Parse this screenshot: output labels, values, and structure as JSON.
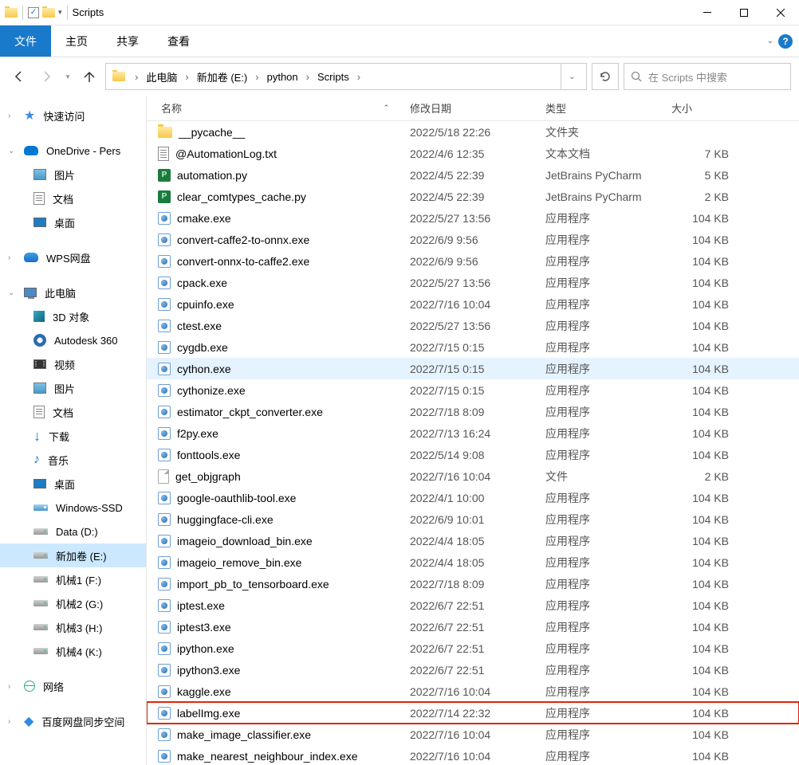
{
  "title": {
    "sep": "|",
    "window": "Scripts"
  },
  "ribbon": {
    "file": "文件",
    "tabs": [
      "主页",
      "共享",
      "查看"
    ]
  },
  "breadcrumb": {
    "items": [
      "此电脑",
      "新加卷 (E:)",
      "python",
      "Scripts"
    ]
  },
  "search": {
    "placeholder": "在 Scripts 中搜索"
  },
  "sidebar": {
    "quick": {
      "root": "快速访问"
    },
    "onedrive": {
      "root": "OneDrive - Pers",
      "items": [
        "图片",
        "文档",
        "桌面"
      ]
    },
    "wps": {
      "root": "WPS网盘"
    },
    "pc": {
      "root": "此电脑",
      "items": [
        {
          "label": "3D 对象",
          "icon": "3d"
        },
        {
          "label": "Autodesk 360",
          "icon": "a360"
        },
        {
          "label": "视频",
          "icon": "video"
        },
        {
          "label": "图片",
          "icon": "pic"
        },
        {
          "label": "文档",
          "icon": "doc"
        },
        {
          "label": "下载",
          "icon": "dl"
        },
        {
          "label": "音乐",
          "icon": "music"
        },
        {
          "label": "桌面",
          "icon": "desk"
        },
        {
          "label": "Windows-SSD",
          "icon": "ssd"
        },
        {
          "label": "Data (D:)",
          "icon": "drive"
        },
        {
          "label": "新加卷 (E:)",
          "icon": "drive",
          "selected": true
        },
        {
          "label": "机械1 (F:)",
          "icon": "drive"
        },
        {
          "label": "机械2 (G:)",
          "icon": "drive"
        },
        {
          "label": "机械3 (H:)",
          "icon": "drive"
        },
        {
          "label": "机械4 (K:)",
          "icon": "drive"
        }
      ]
    },
    "network": {
      "root": "网络"
    },
    "baidu": {
      "root": "百度网盘同步空间"
    }
  },
  "columns": {
    "name": "名称",
    "date": "修改日期",
    "type": "类型",
    "size": "大小"
  },
  "files": [
    {
      "name": "__pycache__",
      "date": "2022/5/18 22:26",
      "type": "文件夹",
      "size": "",
      "icon": "folder"
    },
    {
      "name": "@AutomationLog.txt",
      "date": "2022/4/6 12:35",
      "type": "文本文档",
      "size": "7 KB",
      "icon": "txt"
    },
    {
      "name": "automation.py",
      "date": "2022/4/5 22:39",
      "type": "JetBrains PyCharm",
      "size": "5 KB",
      "icon": "py"
    },
    {
      "name": "clear_comtypes_cache.py",
      "date": "2022/4/5 22:39",
      "type": "JetBrains PyCharm",
      "size": "2 KB",
      "icon": "py"
    },
    {
      "name": "cmake.exe",
      "date": "2022/5/27 13:56",
      "type": "应用程序",
      "size": "104 KB",
      "icon": "exe"
    },
    {
      "name": "convert-caffe2-to-onnx.exe",
      "date": "2022/6/9 9:56",
      "type": "应用程序",
      "size": "104 KB",
      "icon": "exe"
    },
    {
      "name": "convert-onnx-to-caffe2.exe",
      "date": "2022/6/9 9:56",
      "type": "应用程序",
      "size": "104 KB",
      "icon": "exe"
    },
    {
      "name": "cpack.exe",
      "date": "2022/5/27 13:56",
      "type": "应用程序",
      "size": "104 KB",
      "icon": "exe"
    },
    {
      "name": "cpuinfo.exe",
      "date": "2022/7/16 10:04",
      "type": "应用程序",
      "size": "104 KB",
      "icon": "exe"
    },
    {
      "name": "ctest.exe",
      "date": "2022/5/27 13:56",
      "type": "应用程序",
      "size": "104 KB",
      "icon": "exe"
    },
    {
      "name": "cygdb.exe",
      "date": "2022/7/15 0:15",
      "type": "应用程序",
      "size": "104 KB",
      "icon": "exe"
    },
    {
      "name": "cython.exe",
      "date": "2022/7/15 0:15",
      "type": "应用程序",
      "size": "104 KB",
      "icon": "exe",
      "hovered": true
    },
    {
      "name": "cythonize.exe",
      "date": "2022/7/15 0:15",
      "type": "应用程序",
      "size": "104 KB",
      "icon": "exe"
    },
    {
      "name": "estimator_ckpt_converter.exe",
      "date": "2022/7/18 8:09",
      "type": "应用程序",
      "size": "104 KB",
      "icon": "exe"
    },
    {
      "name": "f2py.exe",
      "date": "2022/7/13 16:24",
      "type": "应用程序",
      "size": "104 KB",
      "icon": "exe"
    },
    {
      "name": "fonttools.exe",
      "date": "2022/5/14 9:08",
      "type": "应用程序",
      "size": "104 KB",
      "icon": "exe"
    },
    {
      "name": "get_objgraph",
      "date": "2022/7/16 10:04",
      "type": "文件",
      "size": "2 KB",
      "icon": "file"
    },
    {
      "name": "google-oauthlib-tool.exe",
      "date": "2022/4/1 10:00",
      "type": "应用程序",
      "size": "104 KB",
      "icon": "exe"
    },
    {
      "name": "huggingface-cli.exe",
      "date": "2022/6/9 10:01",
      "type": "应用程序",
      "size": "104 KB",
      "icon": "exe"
    },
    {
      "name": "imageio_download_bin.exe",
      "date": "2022/4/4 18:05",
      "type": "应用程序",
      "size": "104 KB",
      "icon": "exe"
    },
    {
      "name": "imageio_remove_bin.exe",
      "date": "2022/4/4 18:05",
      "type": "应用程序",
      "size": "104 KB",
      "icon": "exe"
    },
    {
      "name": "import_pb_to_tensorboard.exe",
      "date": "2022/7/18 8:09",
      "type": "应用程序",
      "size": "104 KB",
      "icon": "exe"
    },
    {
      "name": "iptest.exe",
      "date": "2022/6/7 22:51",
      "type": "应用程序",
      "size": "104 KB",
      "icon": "exe"
    },
    {
      "name": "iptest3.exe",
      "date": "2022/6/7 22:51",
      "type": "应用程序",
      "size": "104 KB",
      "icon": "exe"
    },
    {
      "name": "ipython.exe",
      "date": "2022/6/7 22:51",
      "type": "应用程序",
      "size": "104 KB",
      "icon": "exe"
    },
    {
      "name": "ipython3.exe",
      "date": "2022/6/7 22:51",
      "type": "应用程序",
      "size": "104 KB",
      "icon": "exe"
    },
    {
      "name": "kaggle.exe",
      "date": "2022/7/16 10:04",
      "type": "应用程序",
      "size": "104 KB",
      "icon": "exe"
    },
    {
      "name": "labelImg.exe",
      "date": "2022/7/14 22:32",
      "type": "应用程序",
      "size": "104 KB",
      "icon": "exe",
      "highlight": true
    },
    {
      "name": "make_image_classifier.exe",
      "date": "2022/7/16 10:04",
      "type": "应用程序",
      "size": "104 KB",
      "icon": "exe"
    },
    {
      "name": "make_nearest_neighbour_index.exe",
      "date": "2022/7/16 10:04",
      "type": "应用程序",
      "size": "104 KB",
      "icon": "exe"
    }
  ]
}
